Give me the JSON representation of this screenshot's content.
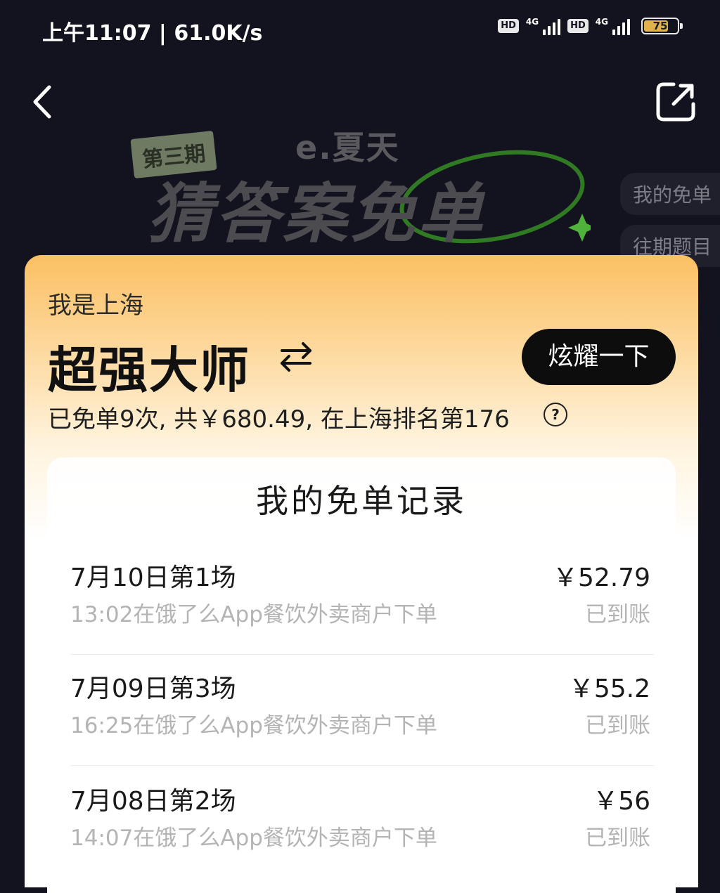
{
  "status_bar": {
    "time": "上午11:07 | 61.0K/s",
    "hd1": "HD",
    "net1": "4G",
    "hd2": "HD",
    "net2": "4G",
    "battery": "75",
    "battery_level": 0.75,
    "battery_color": "#e0b24d"
  },
  "nav": {
    "back_icon": "chevron-left-icon",
    "share_icon": "share-icon"
  },
  "banner": {
    "issue": "第三期",
    "brand": "e.夏天",
    "title": "猜答案免单",
    "accent_color": "#3a9a2a"
  },
  "side_tabs": [
    "我的免单",
    "往期题目"
  ],
  "card": {
    "city_line": "我是上海",
    "rank_title": "超强大师",
    "swap_icon": "swap-icon",
    "flaunt_button": "炫耀一下",
    "summary": "已免单9次, 共￥680.49, 在上海排名第176",
    "help_icon": "?",
    "records_title": "我的免单记录",
    "records": [
      {
        "title": "7月10日第1场",
        "detail": "13:02在饿了么App餐饮外卖商户下单",
        "amount": "￥52.79",
        "status": "已到账"
      },
      {
        "title": "7月09日第3场",
        "detail": "16:25在饿了么App餐饮外卖商户下单",
        "amount": "￥55.2",
        "status": "已到账"
      },
      {
        "title": "7月08日第2场",
        "detail": "14:07在饿了么App餐饮外卖商户下单",
        "amount": "￥56",
        "status": "已到账"
      }
    ]
  }
}
